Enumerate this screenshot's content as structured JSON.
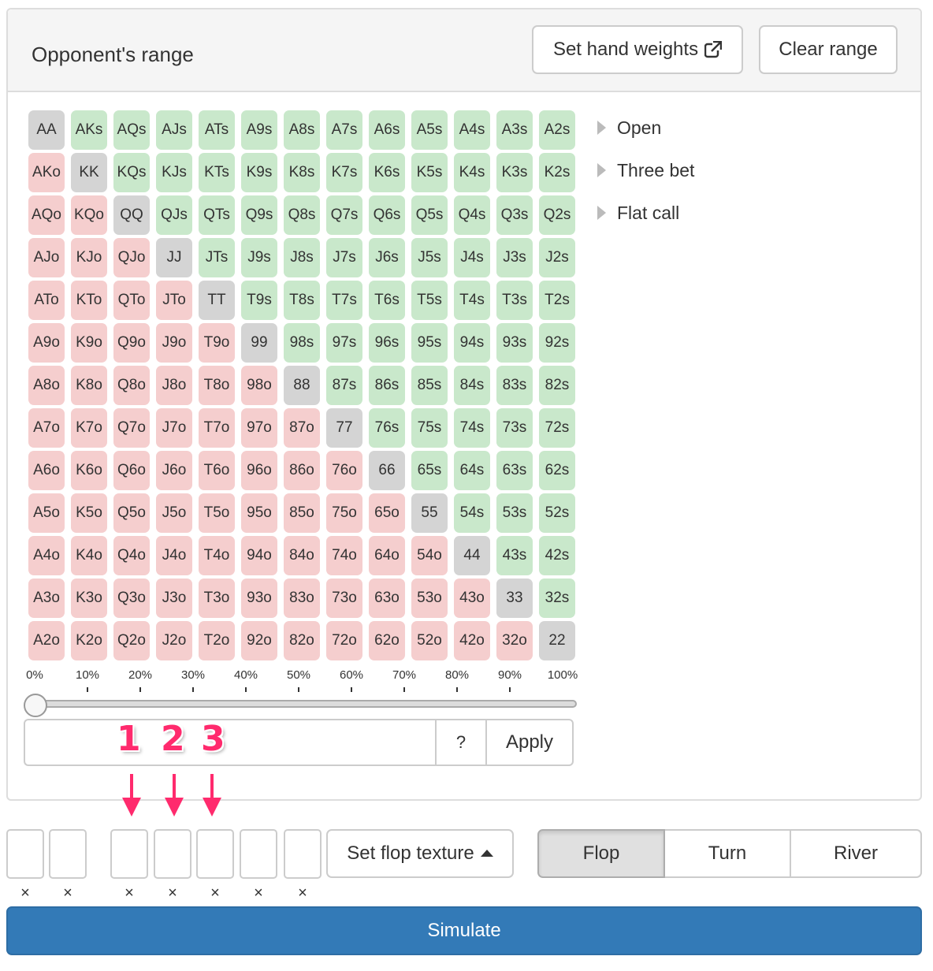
{
  "panel": {
    "title": "Opponent's range",
    "set_hand_weights_label": "Set hand weights",
    "clear_range_label": "Clear range"
  },
  "range_grid": {
    "rows": [
      [
        "AA",
        "AKs",
        "AQs",
        "AJs",
        "ATs",
        "A9s",
        "A8s",
        "A7s",
        "A6s",
        "A5s",
        "A4s",
        "A3s",
        "A2s"
      ],
      [
        "AKo",
        "KK",
        "KQs",
        "KJs",
        "KTs",
        "K9s",
        "K8s",
        "K7s",
        "K6s",
        "K5s",
        "K4s",
        "K3s",
        "K2s"
      ],
      [
        "AQo",
        "KQo",
        "QQ",
        "QJs",
        "QTs",
        "Q9s",
        "Q8s",
        "Q7s",
        "Q6s",
        "Q5s",
        "Q4s",
        "Q3s",
        "Q2s"
      ],
      [
        "AJo",
        "KJo",
        "QJo",
        "JJ",
        "JTs",
        "J9s",
        "J8s",
        "J7s",
        "J6s",
        "J5s",
        "J4s",
        "J3s",
        "J2s"
      ],
      [
        "ATo",
        "KTo",
        "QTo",
        "JTo",
        "TT",
        "T9s",
        "T8s",
        "T7s",
        "T6s",
        "T5s",
        "T4s",
        "T3s",
        "T2s"
      ],
      [
        "A9o",
        "K9o",
        "Q9o",
        "J9o",
        "T9o",
        "99",
        "98s",
        "97s",
        "96s",
        "95s",
        "94s",
        "93s",
        "92s"
      ],
      [
        "A8o",
        "K8o",
        "Q8o",
        "J8o",
        "T8o",
        "98o",
        "88",
        "87s",
        "86s",
        "85s",
        "84s",
        "83s",
        "82s"
      ],
      [
        "A7o",
        "K7o",
        "Q7o",
        "J7o",
        "T7o",
        "97o",
        "87o",
        "77",
        "76s",
        "75s",
        "74s",
        "73s",
        "72s"
      ],
      [
        "A6o",
        "K6o",
        "Q6o",
        "J6o",
        "T6o",
        "96o",
        "86o",
        "76o",
        "66",
        "65s",
        "64s",
        "63s",
        "62s"
      ],
      [
        "A5o",
        "K5o",
        "Q5o",
        "J5o",
        "T5o",
        "95o",
        "85o",
        "75o",
        "65o",
        "55",
        "54s",
        "53s",
        "52s"
      ],
      [
        "A4o",
        "K4o",
        "Q4o",
        "J4o",
        "T4o",
        "94o",
        "84o",
        "74o",
        "64o",
        "54o",
        "44",
        "43s",
        "42s"
      ],
      [
        "A3o",
        "K3o",
        "Q3o",
        "J3o",
        "T3o",
        "93o",
        "83o",
        "73o",
        "63o",
        "53o",
        "43o",
        "33",
        "32s"
      ],
      [
        "A2o",
        "K2o",
        "Q2o",
        "J2o",
        "T2o",
        "92o",
        "82o",
        "72o",
        "62o",
        "52o",
        "42o",
        "32o",
        "22"
      ]
    ],
    "colors": {
      "pair": "#d4d4d4",
      "suited": "#c9e8cb",
      "offsuit": "#f5cece"
    }
  },
  "tree": {
    "items": [
      "Open",
      "Three bet",
      "Flat call"
    ]
  },
  "slider": {
    "ticks": [
      "0%",
      "10%",
      "20%",
      "30%",
      "40%",
      "50%",
      "60%",
      "70%",
      "80%",
      "90%",
      "100%"
    ],
    "value_percent": 0
  },
  "range_input": {
    "value": "",
    "help_label": "?",
    "apply_label": "Apply"
  },
  "annotations": [
    "1",
    "2",
    "3"
  ],
  "board": {
    "slot_count": 7,
    "remove_glyph": "×",
    "set_flop_texture_label": "Set flop texture"
  },
  "streets": {
    "items": [
      "Flop",
      "Turn",
      "River"
    ],
    "active": "Flop"
  },
  "simulate_label": "Simulate",
  "accent_colors": {
    "primary": "#337ab7",
    "annotation": "#ff2a6d"
  }
}
